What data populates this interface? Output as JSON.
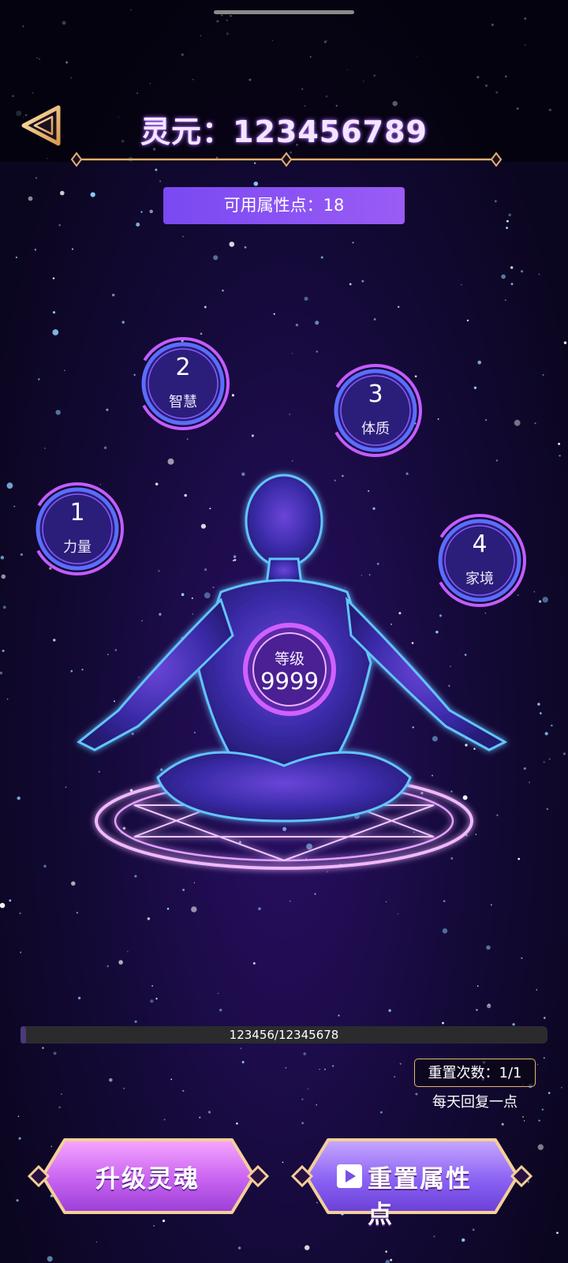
{
  "header": {
    "title": "灵元：123456789",
    "back_icon": "back-triangle-icon"
  },
  "available_points": "可用属性点：18",
  "attributes": [
    {
      "id": "strength",
      "value": "1",
      "label": "力量"
    },
    {
      "id": "wisdom",
      "value": "2",
      "label": "智慧"
    },
    {
      "id": "constitution",
      "value": "3",
      "label": "体质"
    },
    {
      "id": "family",
      "value": "4",
      "label": "家境"
    }
  ],
  "level": {
    "label": "等级",
    "value": "9999"
  },
  "experience": {
    "text": "123456/12345678",
    "fraction": 0.01
  },
  "reset": {
    "count": "重置次数：1/1",
    "note": "每天回复一点"
  },
  "buttons": {
    "upgrade": "升级灵魂",
    "reset_attributes": "重置属性点",
    "video_icon": "play-video-icon"
  },
  "colors": {
    "accent_gold": "#e9b77a",
    "accent_purple": "#9b5cf6",
    "ring_purple": "#c65cff",
    "ring_blue": "#4a6bff"
  }
}
